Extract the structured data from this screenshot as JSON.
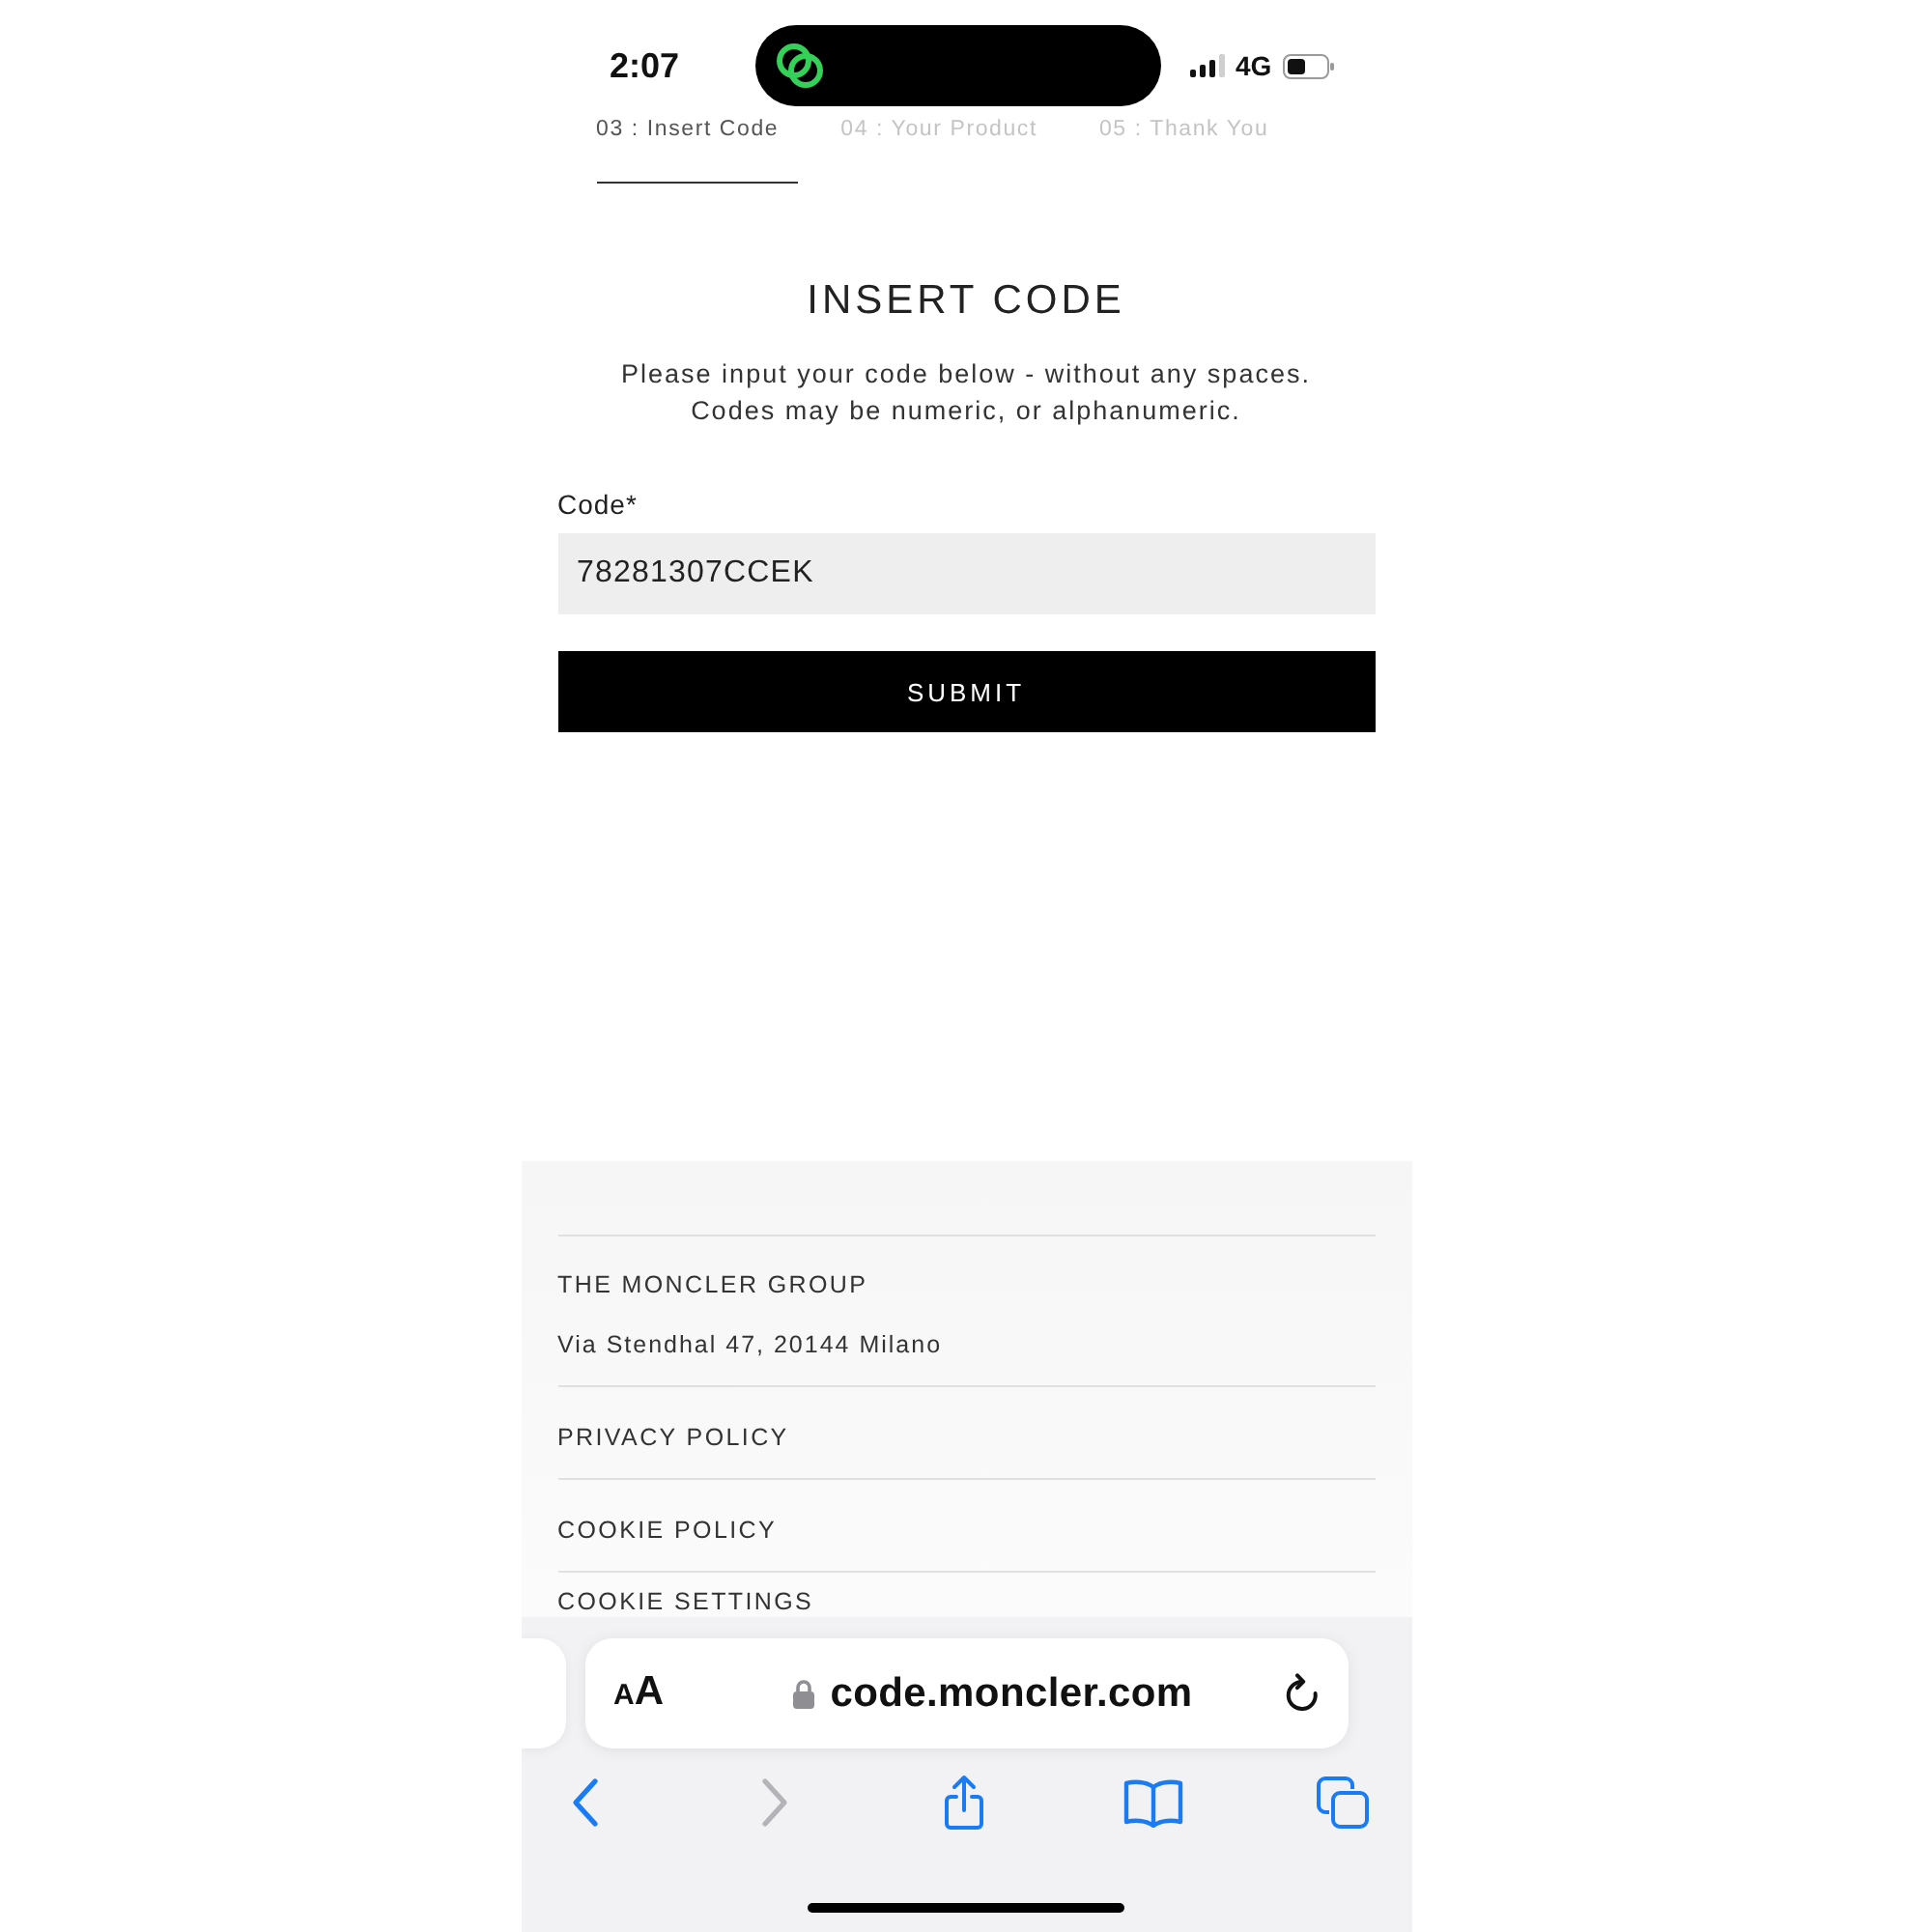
{
  "status_bar": {
    "time": "2:07",
    "network": "4G"
  },
  "steps": [
    {
      "label": "03 : Insert Code",
      "selected": true
    },
    {
      "label": "04 : Your Product",
      "selected": false
    },
    {
      "label": "05 : Thank You",
      "selected": false
    }
  ],
  "form": {
    "title": "INSERT CODE",
    "description": [
      "Please input your code below - without any spaces.",
      "Codes may be numeric, or alphanumeric."
    ],
    "field": {
      "label": "Code*",
      "value": "78281307CCEK"
    },
    "submit": "SUBMIT"
  },
  "footer": {
    "company": "THE MONCLER GROUP",
    "address": "Via Stendhal 47, 20144 Milano",
    "links": [
      "PRIVACY POLICY",
      "COOKIE POLICY",
      "COOKIE SETTINGS"
    ]
  },
  "browser": {
    "text_size": "AA",
    "url": "code.moncler.com",
    "toolbar": [
      {
        "kind": "back",
        "disabled": false
      },
      {
        "kind": "forward",
        "disabled": true
      },
      {
        "kind": "share",
        "disabled": false
      },
      {
        "kind": "bookmarks",
        "disabled": false
      },
      {
        "kind": "tabs",
        "disabled": false
      }
    ]
  }
}
